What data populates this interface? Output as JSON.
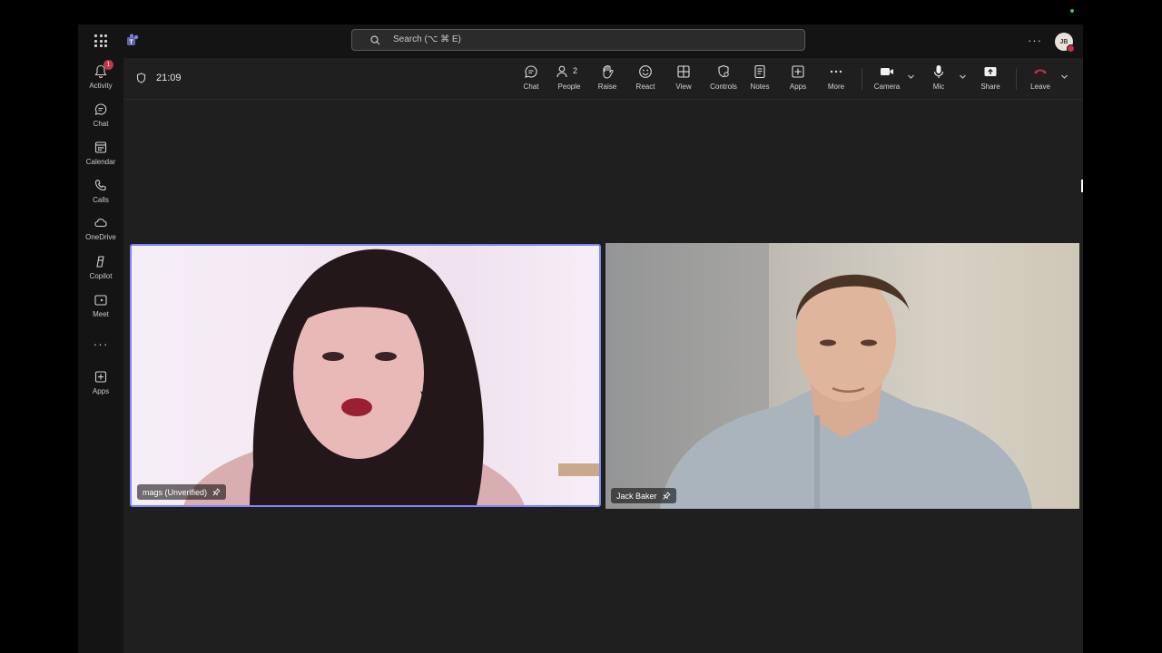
{
  "topbar": {
    "search_placeholder": "Search (⌥ ⌘ E)",
    "more": "···",
    "avatar_initials": "JB"
  },
  "rail": {
    "items": [
      {
        "label": "Activity",
        "icon": "bell-icon",
        "badge": "1"
      },
      {
        "label": "Chat",
        "icon": "chat-icon"
      },
      {
        "label": "Calendar",
        "icon": "calendar-icon"
      },
      {
        "label": "Calls",
        "icon": "phone-icon"
      },
      {
        "label": "OneDrive",
        "icon": "cloud-icon"
      },
      {
        "label": "Copilot",
        "icon": "copilot-icon"
      },
      {
        "label": "Meet",
        "icon": "video-icon"
      },
      {
        "label": "Apps",
        "icon": "add-apps-icon"
      }
    ],
    "more": "···"
  },
  "meeting": {
    "timer": "21:09",
    "controls": {
      "chat": "Chat",
      "people": "People",
      "people_count": "2",
      "raise": "Raise",
      "react": "React",
      "view": "View",
      "controls": "Controls",
      "notes": "Notes",
      "apps": "Apps",
      "more": "More",
      "camera": "Camera",
      "mic": "Mic",
      "share": "Share",
      "leave": "Leave"
    }
  },
  "participants": [
    {
      "name": "mags (Unverified)"
    },
    {
      "name": "Jack Baker"
    }
  ],
  "colors": {
    "accent": "#7f85f5",
    "leave": "#c4314b",
    "background": "#1f1f1f"
  }
}
